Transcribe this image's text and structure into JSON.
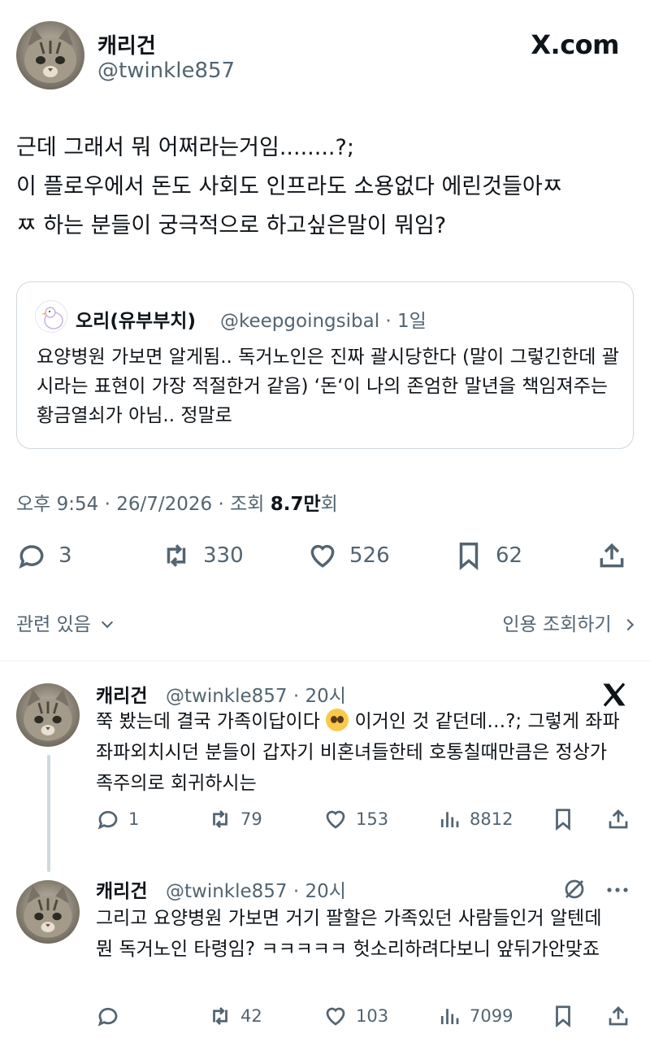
{
  "header": {
    "name": "캐리건",
    "handle": "@twinkle857",
    "brand": "X.com"
  },
  "tweet": {
    "text": "근데 그래서 뭐 어쩌라는거임........?;\n이 플로우에서 돈도 사회도 인프라도 소용없다 에린것들아ㅉ\nㅉ 하는 분들이 궁극적으로 하고싶은말이 뭐임?",
    "quote": {
      "name": "오리(유부부치)",
      "handle": "@keepgoingsibal · 1일",
      "text": "요양병원 가보면 알게됨.. 독거노인은 진짜 괄시당한다 (말이 그렇긴한데 괄시라는 표현이 가장 적절한거 같음) ‘돈‘이 나의 존엄한 말년을 책임져주는 황금열쇠가 아님.. 정말로"
    },
    "meta_prefix": "오후 9:54 · 26/7/2026 · 조회 ",
    "meta_views": "8.7만",
    "meta_suffix": "회",
    "replies": "3",
    "retweets": "330",
    "likes": "526",
    "bookmarks": "62"
  },
  "related": {
    "left": "관련 있음",
    "right": "인용 조회하기"
  },
  "replies": [
    {
      "name": "캐리건",
      "handle": "@twinkle857 · 20시",
      "text_before": "쭉 봤는데 결국 가족이답이다",
      "text_after": " 이거인 것 같던데…?; 그렇게 좌파좌파외치시던 분들이 갑자기 비혼녀들한테 호통칠때만큼은 정상가족주의로 회귀하시는",
      "replies": "1",
      "retweets": "79",
      "likes": "153",
      "views": "8812"
    },
    {
      "name": "캐리건",
      "handle": "@twinkle857 · 20시",
      "text": "그리고 요양병원 가보면 거기 팔할은 가족있던 사람들인거 알텐데 뭔 독거노인 타령임? ㅋㅋㅋㅋㅋ 헛소리하려다보니 앞뒤가안맞죠",
      "replies": "",
      "retweets": "42",
      "likes": "103",
      "views": "7099"
    }
  ]
}
